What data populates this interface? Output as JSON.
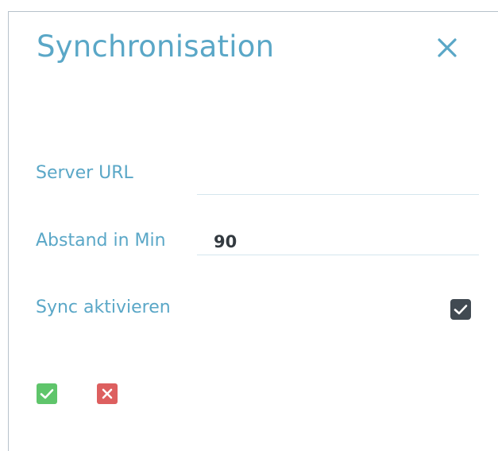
{
  "dialog": {
    "title": "Synchronisation",
    "close_icon": "close-icon"
  },
  "form": {
    "server_url": {
      "label": "Server URL",
      "value": ""
    },
    "interval": {
      "label": "Abstand in Min",
      "value": "90"
    },
    "sync_enabled": {
      "label": "Sync aktivieren",
      "checked": true,
      "icon": "checkmark-icon"
    }
  },
  "actions": {
    "confirm_icon": "checkmark-icon",
    "cancel_icon": "close-icon",
    "confirm_color": "#5fc56b",
    "cancel_color": "#dd5f5f"
  },
  "colors": {
    "accent": "#5aa7c7",
    "checkbox": "#414a52"
  }
}
